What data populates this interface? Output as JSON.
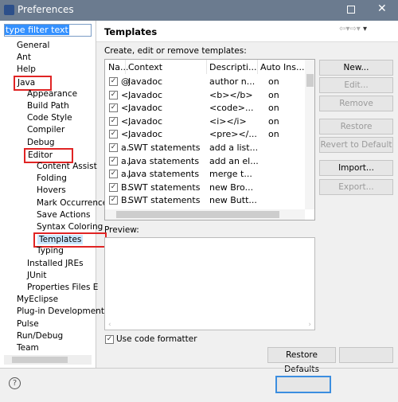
{
  "window": {
    "title": "Preferences"
  },
  "filter": {
    "value": "type filter text"
  },
  "tree": [
    {
      "label": "General",
      "level": 0
    },
    {
      "label": "Ant",
      "level": 0
    },
    {
      "label": "Help",
      "level": 0
    },
    {
      "label": "Java",
      "level": 0,
      "highlight": true
    },
    {
      "label": "Appearance",
      "level": 1
    },
    {
      "label": "Build Path",
      "level": 1
    },
    {
      "label": "Code Style",
      "level": 1
    },
    {
      "label": "Compiler",
      "level": 1
    },
    {
      "label": "Debug",
      "level": 1
    },
    {
      "label": "Editor",
      "level": 1,
      "highlight": true
    },
    {
      "label": "Content Assist",
      "level": 2
    },
    {
      "label": "Folding",
      "level": 2
    },
    {
      "label": "Hovers",
      "level": 2
    },
    {
      "label": "Mark Occurrences",
      "level": 2
    },
    {
      "label": "Save Actions",
      "level": 2
    },
    {
      "label": "Syntax Coloring",
      "level": 2
    },
    {
      "label": "Templates",
      "level": 2,
      "highlight": true,
      "selected": true
    },
    {
      "label": "Typing",
      "level": 2
    },
    {
      "label": "Installed JREs",
      "level": 1
    },
    {
      "label": "JUnit",
      "level": 1
    },
    {
      "label": "Properties Files E",
      "level": 1
    },
    {
      "label": "MyEclipse",
      "level": 0
    },
    {
      "label": "Plug-in Development",
      "level": 0
    },
    {
      "label": "Pulse",
      "level": 0
    },
    {
      "label": "Run/Debug",
      "level": 0
    },
    {
      "label": "Team",
      "level": 0
    }
  ],
  "page": {
    "title": "Templates",
    "subtitle": "Create, edit or remove templates:",
    "preview_label": "Preview:",
    "use_formatter_label": "Use code formatter",
    "use_formatter_checked": true
  },
  "table": {
    "columns": [
      "Na...",
      "Context",
      "Descripti...",
      "Auto Ins..."
    ],
    "rows": [
      [
        "@",
        "Javadoc",
        "author n...",
        "on"
      ],
      [
        "<.",
        "Javadoc",
        "<b></b>",
        "on"
      ],
      [
        "<.",
        "Javadoc",
        "<code>...",
        "on"
      ],
      [
        "<.",
        "Javadoc",
        "<i></i>",
        "on"
      ],
      [
        "<.",
        "Javadoc",
        "<pre></...",
        "on"
      ],
      [
        "a..",
        "SWT statements",
        "add a list...",
        ""
      ],
      [
        "a..",
        "Java statements",
        "add an el...",
        ""
      ],
      [
        "a..",
        "Java statements",
        "merge t...",
        ""
      ],
      [
        "B..",
        "SWT statements",
        "new Bro...",
        ""
      ],
      [
        "B..",
        "SWT statements",
        "new Butt...",
        ""
      ]
    ]
  },
  "buttons": {
    "new": "New...",
    "edit": "Edit...",
    "remove": "Remove",
    "restore_removed": "Restore Removed",
    "revert": "Revert to Default",
    "import": "Import...",
    "export": "Export...",
    "restore_defaults": "Restore Defaults"
  },
  "colors": {
    "highlight_box": "#e02424",
    "selection": "#cce8ff",
    "titlebar": "#6b7b8f"
  }
}
